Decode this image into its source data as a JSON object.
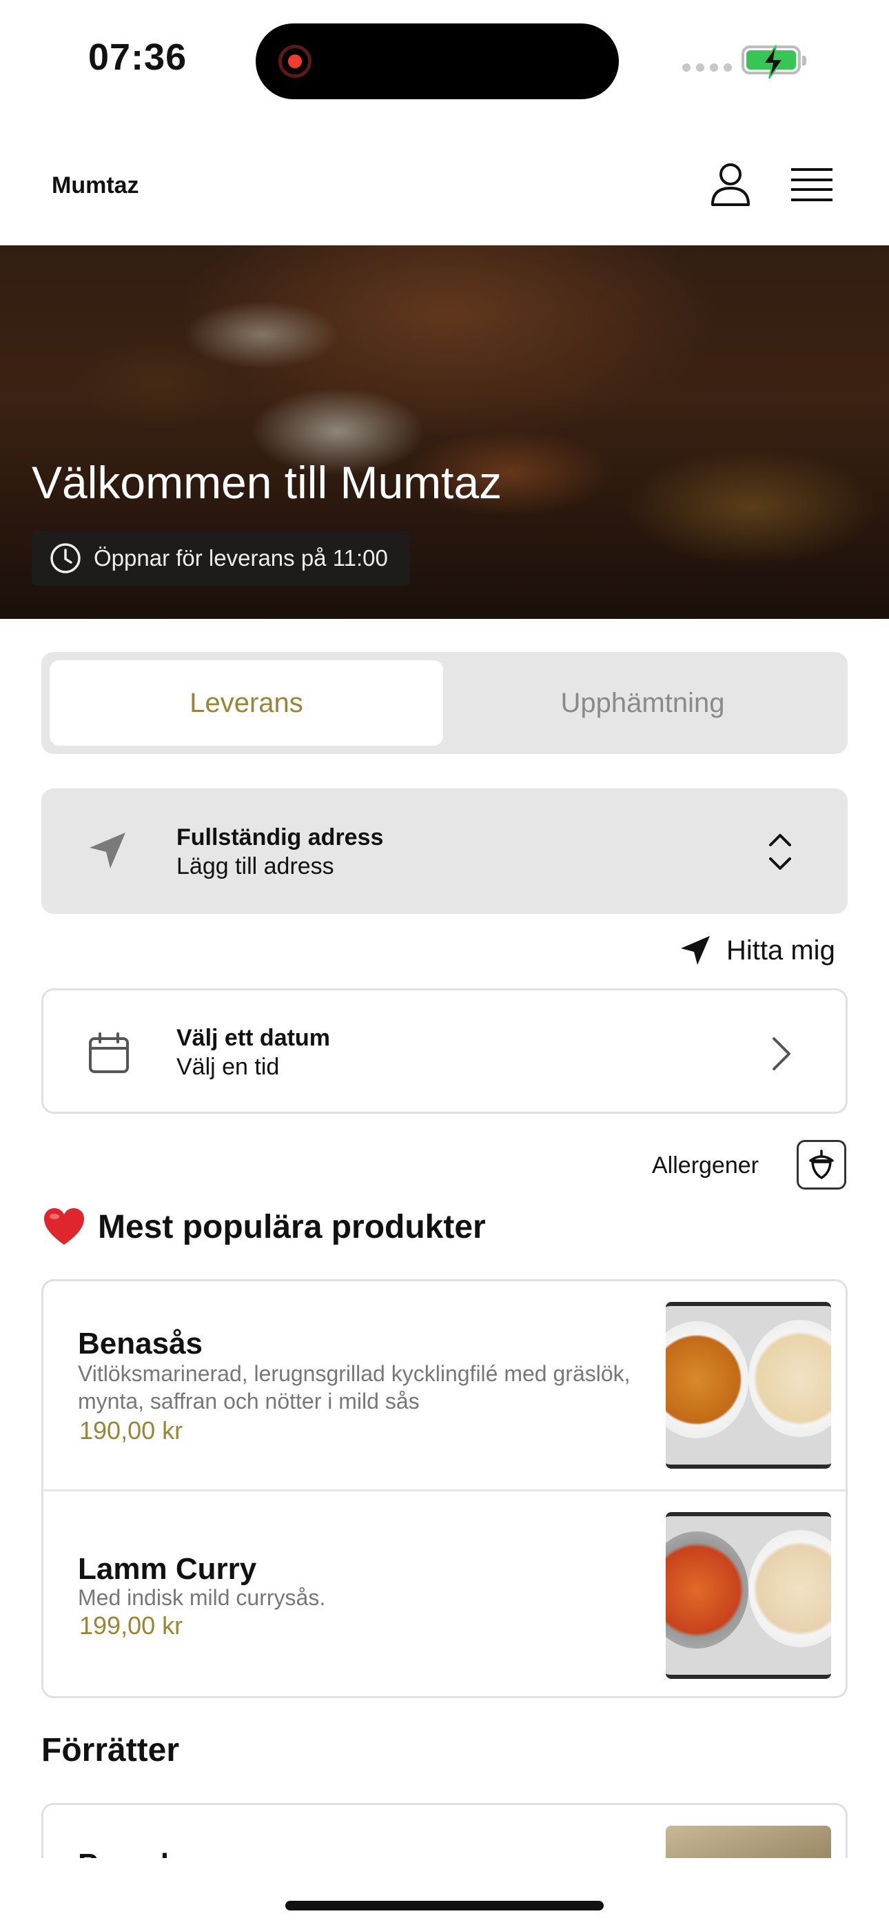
{
  "status_bar": {
    "time": "07:36"
  },
  "header": {
    "brand": "Mumtaz"
  },
  "hero": {
    "title": "Välkommen till Mumtaz",
    "opening_notice": "Öppnar för leverans på 11:00"
  },
  "tabs": [
    {
      "label": "Leverans",
      "selected": true
    },
    {
      "label": "Upphämtning",
      "selected": false
    }
  ],
  "address": {
    "title": "Fullständig adress",
    "placeholder": "Lägg till adress"
  },
  "find_me": {
    "label": "Hitta mig"
  },
  "schedule": {
    "date_label": "Välj ett datum",
    "time_label": "Välj en tid"
  },
  "allergens": {
    "label": "Allergener"
  },
  "popular": {
    "heading": "Mest populära produkter",
    "items": [
      {
        "name": "Benasås",
        "description": "Vitlöksmarinerad, lerugnsgrillad kycklingfilé med gräslök, mynta, saffran och nötter i mild sås",
        "price": "190,00 kr"
      },
      {
        "name": "Lamm Curry",
        "description": "Med indisk mild currysås.",
        "price": "199,00 kr"
      }
    ]
  },
  "starters": {
    "heading": "Förrätter",
    "items": [
      {
        "name": "Papadam"
      }
    ]
  },
  "colors": {
    "accent_gold": "#9a8537",
    "panel_gray": "#e6e6e6",
    "battery_green": "#39c556",
    "record_red": "#f23b30"
  }
}
